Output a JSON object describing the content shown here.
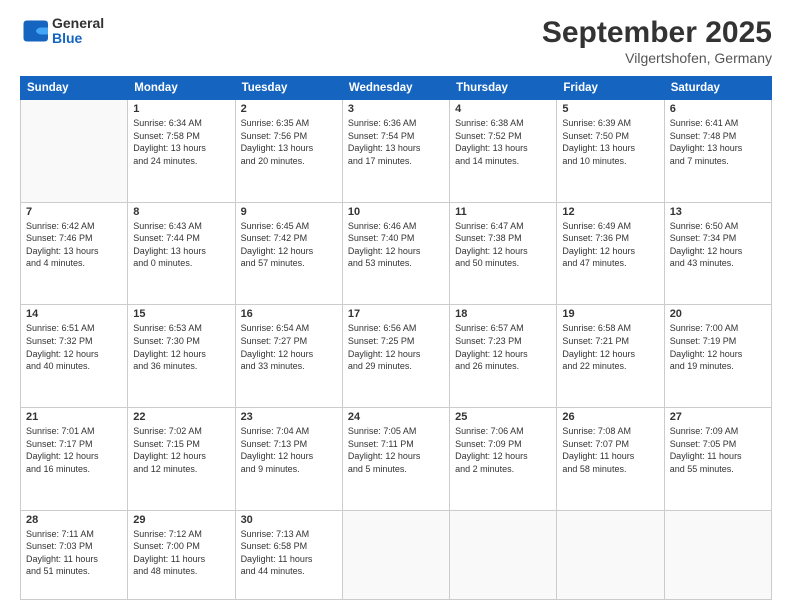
{
  "header": {
    "logo": {
      "general": "General",
      "blue": "Blue"
    },
    "title": "September 2025",
    "location": "Vilgertshofen, Germany"
  },
  "days_of_week": [
    "Sunday",
    "Monday",
    "Tuesday",
    "Wednesday",
    "Thursday",
    "Friday",
    "Saturday"
  ],
  "weeks": [
    [
      {
        "date": "",
        "info": ""
      },
      {
        "date": "1",
        "info": "Sunrise: 6:34 AM\nSunset: 7:58 PM\nDaylight: 13 hours\nand 24 minutes."
      },
      {
        "date": "2",
        "info": "Sunrise: 6:35 AM\nSunset: 7:56 PM\nDaylight: 13 hours\nand 20 minutes."
      },
      {
        "date": "3",
        "info": "Sunrise: 6:36 AM\nSunset: 7:54 PM\nDaylight: 13 hours\nand 17 minutes."
      },
      {
        "date": "4",
        "info": "Sunrise: 6:38 AM\nSunset: 7:52 PM\nDaylight: 13 hours\nand 14 minutes."
      },
      {
        "date": "5",
        "info": "Sunrise: 6:39 AM\nSunset: 7:50 PM\nDaylight: 13 hours\nand 10 minutes."
      },
      {
        "date": "6",
        "info": "Sunrise: 6:41 AM\nSunset: 7:48 PM\nDaylight: 13 hours\nand 7 minutes."
      }
    ],
    [
      {
        "date": "7",
        "info": "Sunrise: 6:42 AM\nSunset: 7:46 PM\nDaylight: 13 hours\nand 4 minutes."
      },
      {
        "date": "8",
        "info": "Sunrise: 6:43 AM\nSunset: 7:44 PM\nDaylight: 13 hours\nand 0 minutes."
      },
      {
        "date": "9",
        "info": "Sunrise: 6:45 AM\nSunset: 7:42 PM\nDaylight: 12 hours\nand 57 minutes."
      },
      {
        "date": "10",
        "info": "Sunrise: 6:46 AM\nSunset: 7:40 PM\nDaylight: 12 hours\nand 53 minutes."
      },
      {
        "date": "11",
        "info": "Sunrise: 6:47 AM\nSunset: 7:38 PM\nDaylight: 12 hours\nand 50 minutes."
      },
      {
        "date": "12",
        "info": "Sunrise: 6:49 AM\nSunset: 7:36 PM\nDaylight: 12 hours\nand 47 minutes."
      },
      {
        "date": "13",
        "info": "Sunrise: 6:50 AM\nSunset: 7:34 PM\nDaylight: 12 hours\nand 43 minutes."
      }
    ],
    [
      {
        "date": "14",
        "info": "Sunrise: 6:51 AM\nSunset: 7:32 PM\nDaylight: 12 hours\nand 40 minutes."
      },
      {
        "date": "15",
        "info": "Sunrise: 6:53 AM\nSunset: 7:30 PM\nDaylight: 12 hours\nand 36 minutes."
      },
      {
        "date": "16",
        "info": "Sunrise: 6:54 AM\nSunset: 7:27 PM\nDaylight: 12 hours\nand 33 minutes."
      },
      {
        "date": "17",
        "info": "Sunrise: 6:56 AM\nSunset: 7:25 PM\nDaylight: 12 hours\nand 29 minutes."
      },
      {
        "date": "18",
        "info": "Sunrise: 6:57 AM\nSunset: 7:23 PM\nDaylight: 12 hours\nand 26 minutes."
      },
      {
        "date": "19",
        "info": "Sunrise: 6:58 AM\nSunset: 7:21 PM\nDaylight: 12 hours\nand 22 minutes."
      },
      {
        "date": "20",
        "info": "Sunrise: 7:00 AM\nSunset: 7:19 PM\nDaylight: 12 hours\nand 19 minutes."
      }
    ],
    [
      {
        "date": "21",
        "info": "Sunrise: 7:01 AM\nSunset: 7:17 PM\nDaylight: 12 hours\nand 16 minutes."
      },
      {
        "date": "22",
        "info": "Sunrise: 7:02 AM\nSunset: 7:15 PM\nDaylight: 12 hours\nand 12 minutes."
      },
      {
        "date": "23",
        "info": "Sunrise: 7:04 AM\nSunset: 7:13 PM\nDaylight: 12 hours\nand 9 minutes."
      },
      {
        "date": "24",
        "info": "Sunrise: 7:05 AM\nSunset: 7:11 PM\nDaylight: 12 hours\nand 5 minutes."
      },
      {
        "date": "25",
        "info": "Sunrise: 7:06 AM\nSunset: 7:09 PM\nDaylight: 12 hours\nand 2 minutes."
      },
      {
        "date": "26",
        "info": "Sunrise: 7:08 AM\nSunset: 7:07 PM\nDaylight: 11 hours\nand 58 minutes."
      },
      {
        "date": "27",
        "info": "Sunrise: 7:09 AM\nSunset: 7:05 PM\nDaylight: 11 hours\nand 55 minutes."
      }
    ],
    [
      {
        "date": "28",
        "info": "Sunrise: 7:11 AM\nSunset: 7:03 PM\nDaylight: 11 hours\nand 51 minutes."
      },
      {
        "date": "29",
        "info": "Sunrise: 7:12 AM\nSunset: 7:00 PM\nDaylight: 11 hours\nand 48 minutes."
      },
      {
        "date": "30",
        "info": "Sunrise: 7:13 AM\nSunset: 6:58 PM\nDaylight: 11 hours\nand 44 minutes."
      },
      {
        "date": "",
        "info": ""
      },
      {
        "date": "",
        "info": ""
      },
      {
        "date": "",
        "info": ""
      },
      {
        "date": "",
        "info": ""
      }
    ]
  ]
}
